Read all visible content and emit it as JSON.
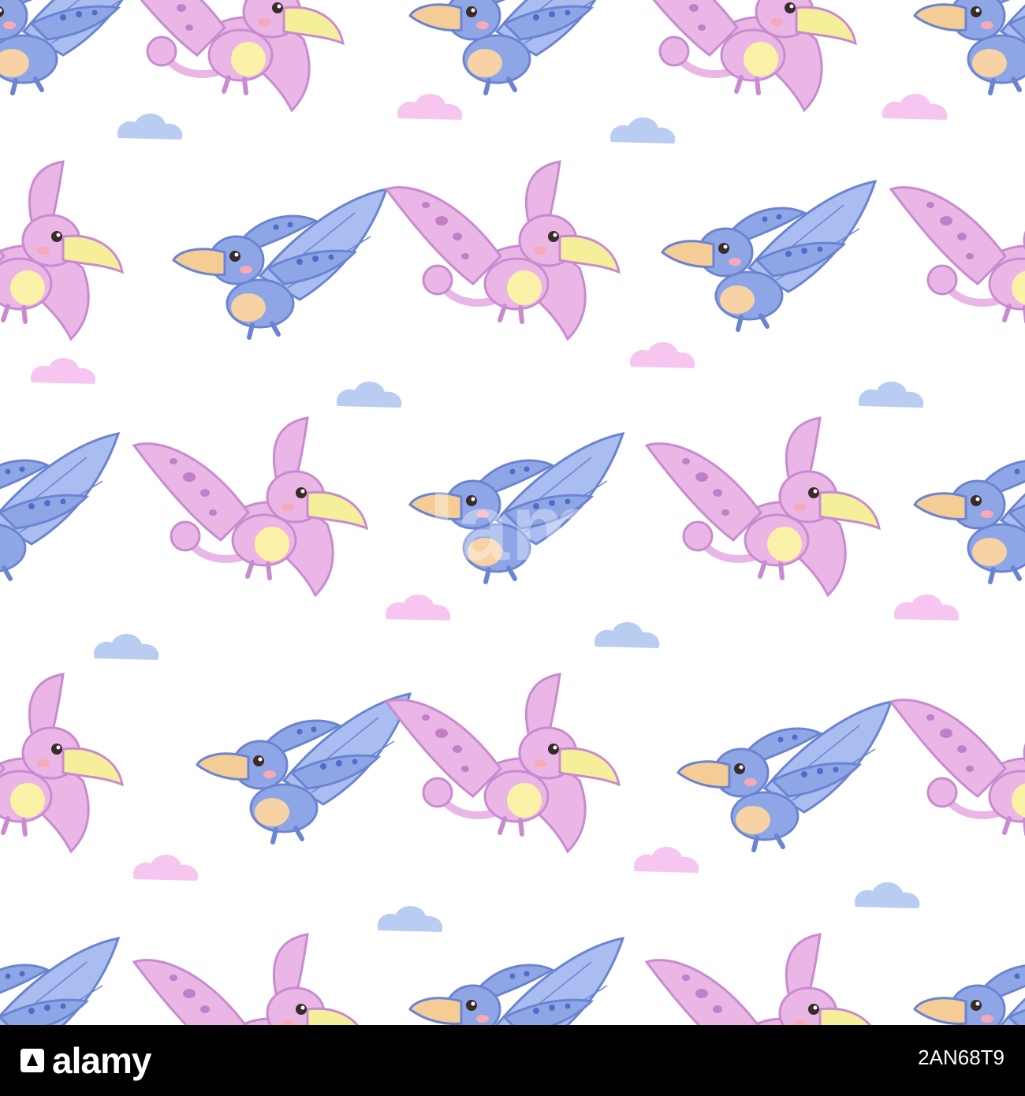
{
  "pattern": {
    "background": "#ffffff",
    "colors": {
      "pink_body": "#e9b6e6",
      "pink_outline": "#c98bd0",
      "pink_spots": "#c17fc8",
      "pink_belly": "#fbf2a8",
      "blue_body": "#8fa6e6",
      "blue_wing": "#a9bdf0",
      "blue_outline": "#6b84d1",
      "blue_spots": "#4f6cc8",
      "blue_belly": "#f7d2a4",
      "beak_pink": "#f6ef9a",
      "beak_blue": "#f3cc96",
      "cloud_pink": "#f6c6f0",
      "cloud_blue": "#b9ccf2"
    },
    "characters": [
      "pink-pterodactyl",
      "blue-pterodactyl"
    ]
  },
  "watermark": {
    "text": "alamy"
  },
  "footer": {
    "logo_text": "alamy",
    "image_id": "2AN68T9",
    "logo_icon": "alamy-logo-icon"
  }
}
